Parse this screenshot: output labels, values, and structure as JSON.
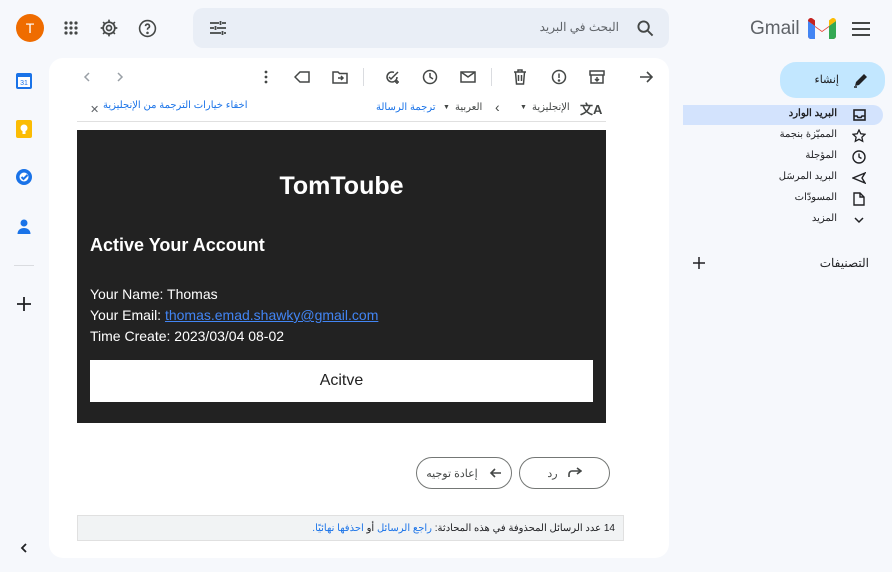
{
  "app": {
    "name": "Gmail",
    "avatar_letter": "T",
    "avatar_color": "#ef6c00",
    "accent": "#0b57d0"
  },
  "search": {
    "placeholder": "البحث في البريد"
  },
  "sidebar": {
    "compose_label": "إنشاء",
    "items": [
      {
        "label": "البريد الوارد",
        "icon": "inbox-icon",
        "active": true
      },
      {
        "label": "المميّزة بنجمة",
        "icon": "star-icon"
      },
      {
        "label": "المؤجلة",
        "icon": "clock-icon"
      },
      {
        "label": "البريد المرسَل",
        "icon": "send-icon"
      },
      {
        "label": "المسودّات",
        "icon": "draft-icon"
      },
      {
        "label": "المزيد",
        "icon": "chevron-down-icon"
      }
    ],
    "labels_heading": "التصنيفات"
  },
  "translation_bar": {
    "source_lang": "الإنجليزية",
    "target_lang": "العربية",
    "translate_link": "ترجمة الرسالة",
    "hide_options": "اخفاء خيارات الترجمة من الإنجليزية"
  },
  "email": {
    "brand": "TomToube",
    "heading": "Active Your Account",
    "name_line": "Your Name: Thomas",
    "email_label": "Your Email: ",
    "email_value": "thomas.emad.shawky@gmail.com",
    "time_line": "Time Create: 2023/03/04 08-02",
    "button_label": "Acitve"
  },
  "actions": {
    "reply_label": "رد",
    "forward_label": "إعادة توجيه"
  },
  "deleted_notice": {
    "count": "14",
    "text": "عدد الرسائل المحذوفة في هذه المحادثة:",
    "view_link": "راجع الرسائل",
    "or_text": "أو",
    "delete_link": "احذفها نهائيًا."
  }
}
